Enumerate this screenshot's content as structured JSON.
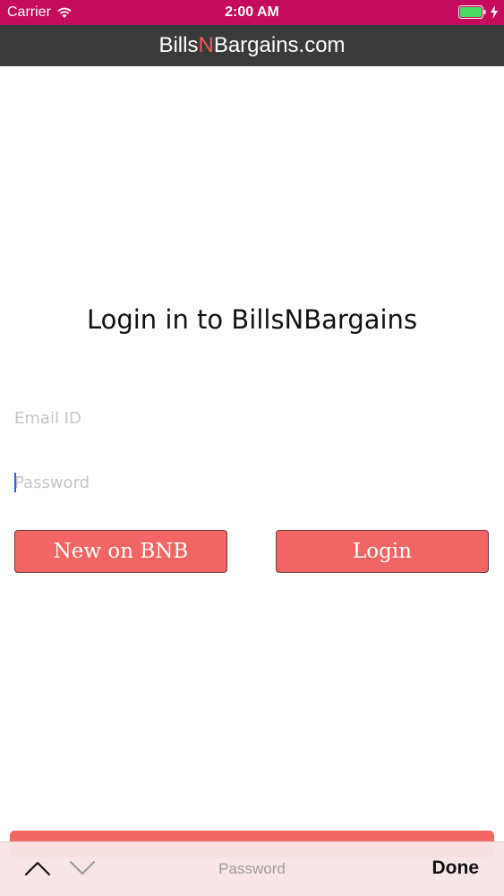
{
  "status_bar": {
    "carrier": "Carrier",
    "time": "2:00 AM",
    "icons": [
      "wifi-icon",
      "battery-icon",
      "charging-bolt-icon"
    ]
  },
  "nav": {
    "brand_prefix": "Bills",
    "brand_n": "N",
    "brand_suffix": "Bargains.com"
  },
  "login": {
    "title": "Login in to BillsNBargains",
    "email_placeholder": "Email ID",
    "password_placeholder": "Password",
    "new_button": "New on BNB",
    "login_button": "Login"
  },
  "keyboard_accessory": {
    "field_label": "Password",
    "done_label": "Done",
    "icons": [
      "chevron-up-icon",
      "chevron-down-icon"
    ]
  },
  "colors": {
    "status_bar": "#c40b5c",
    "nav_bar": "#3a3a3a",
    "brand_accent": "#f05a5a",
    "button": "#f26565",
    "caret": "#2f5dff"
  }
}
